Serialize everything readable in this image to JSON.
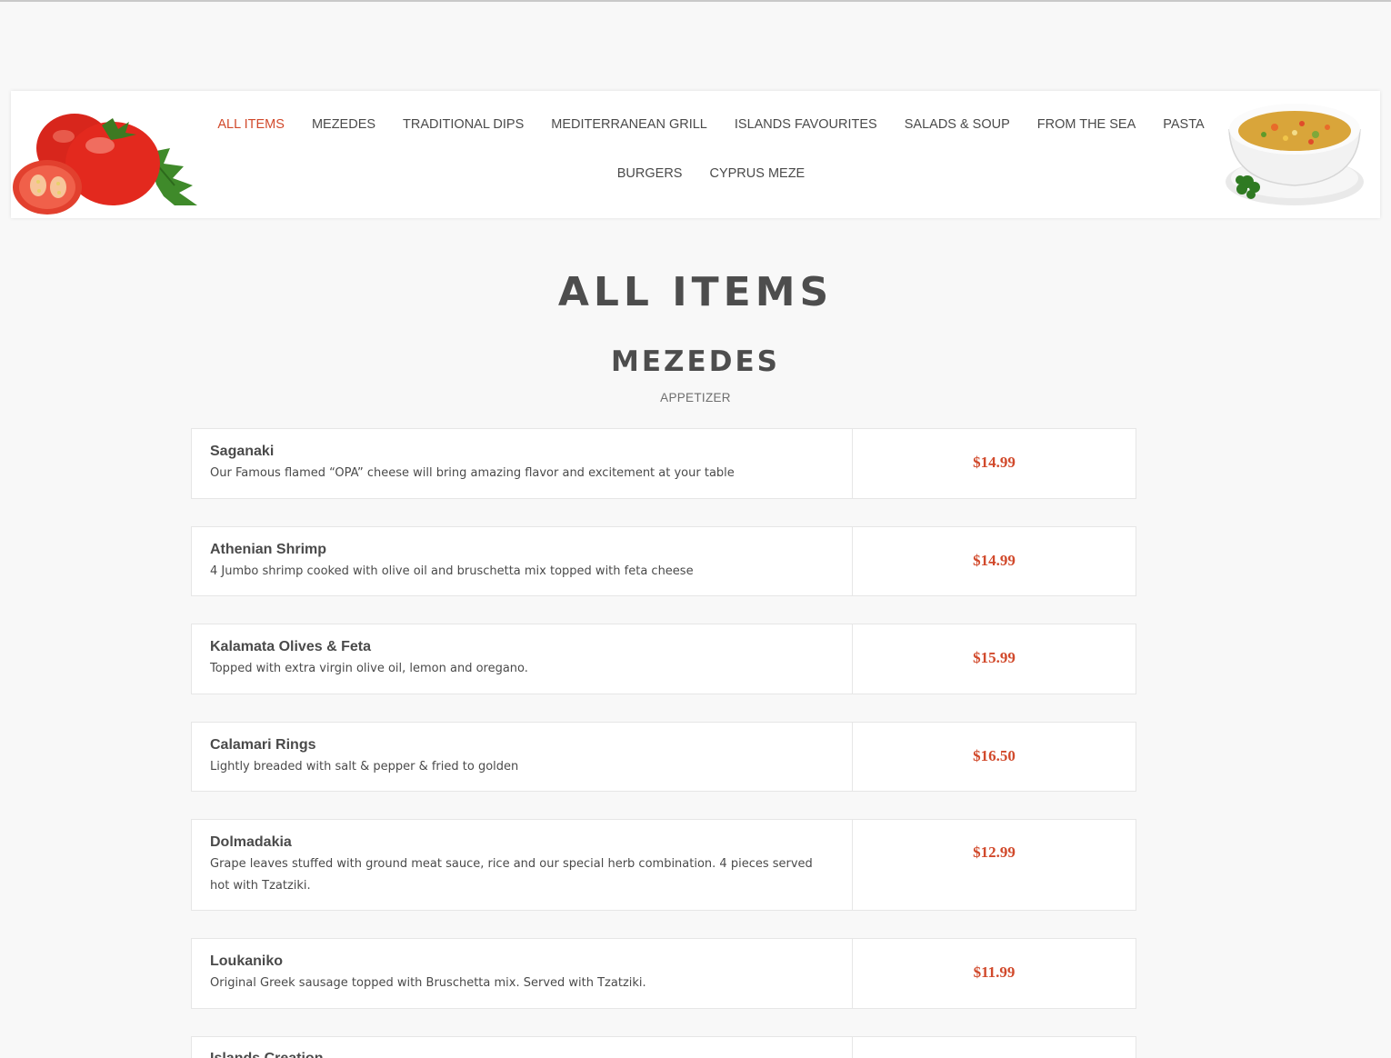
{
  "nav": {
    "row1": [
      "ALL ITEMS",
      "MEZEDES",
      "TRADITIONAL DIPS",
      "MEDITERRANEAN GRILL",
      "ISLANDS FAVOURITES",
      "SALADS & SOUP",
      "FROM THE SEA",
      "PASTA"
    ],
    "row2": [
      "BURGERS",
      "CYPRUS MEZE"
    ],
    "active": "ALL ITEMS"
  },
  "colors": {
    "accent": "#d1492b",
    "text": "#4a4a4a",
    "background": "#f8f8f8"
  },
  "page_title": "ALL ITEMS",
  "section": {
    "title": "MEZEDES",
    "subtitle": "APPETIZER"
  },
  "items": [
    {
      "name": "Saganaki",
      "desc": "Our Famous flamed “OPA” cheese will bring amazing flavor and excitement at your table",
      "price": "$14.99"
    },
    {
      "name": "Athenian Shrimp",
      "desc": "4 Jumbo shrimp cooked with olive oil and bruschetta mix topped with feta cheese",
      "price": "$14.99"
    },
    {
      "name": "Kalamata Olives & Feta",
      "desc": "Topped with extra virgin olive oil, lemon and oregano.",
      "price": "$15.99"
    },
    {
      "name": "Calamari Rings",
      "desc": "Lightly breaded with salt & pepper & fried to golden",
      "price": "$16.50"
    },
    {
      "name": "Dolmadakia",
      "desc": "Grape leaves stuffed with ground meat sauce, rice and our special herb combination. 4 pieces served hot with Tzatziki.",
      "price": "$12.99"
    },
    {
      "name": "Loukaniko",
      "desc": "Original Greek sausage topped with Bruschetta mix. Served with Tzatziki.",
      "price": "$11.99"
    },
    {
      "name": "Islands Creation",
      "desc": "",
      "price": ""
    }
  ]
}
